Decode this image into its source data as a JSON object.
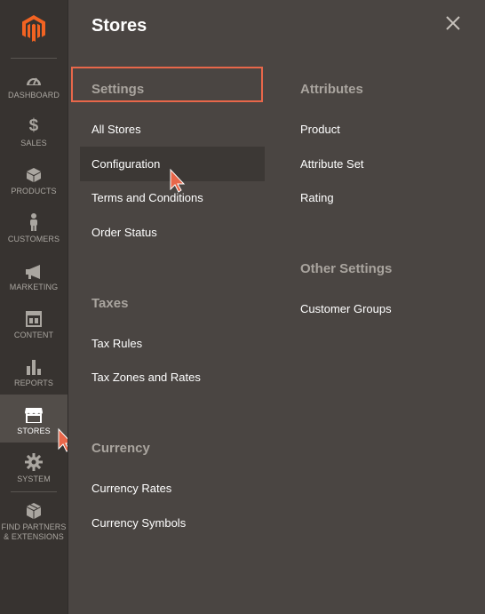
{
  "sidebar": {
    "items": [
      {
        "key": "dashboard",
        "label": "DASHBOARD"
      },
      {
        "key": "sales",
        "label": "SALES"
      },
      {
        "key": "products",
        "label": "PRODUCTS"
      },
      {
        "key": "customers",
        "label": "CUSTOMERS"
      },
      {
        "key": "marketing",
        "label": "MARKETING"
      },
      {
        "key": "content",
        "label": "CONTENT"
      },
      {
        "key": "reports",
        "label": "REPORTS"
      },
      {
        "key": "stores",
        "label": "STORES"
      },
      {
        "key": "system",
        "label": "SYSTEM"
      },
      {
        "key": "partners",
        "label_line1": "FIND PARTNERS",
        "label_line2": "& EXTENSIONS"
      }
    ],
    "active": "stores"
  },
  "panel": {
    "title": "Stores",
    "settings": {
      "title": "Settings",
      "links": [
        "All Stores",
        "Configuration",
        "Terms and Conditions",
        "Order Status"
      ]
    },
    "taxes": {
      "title": "Taxes",
      "links": [
        "Tax Rules",
        "Tax Zones and Rates"
      ]
    },
    "currency": {
      "title": "Currency",
      "links": [
        "Currency Rates",
        "Currency Symbols"
      ]
    },
    "attributes": {
      "title": "Attributes",
      "links": [
        "Product",
        "Attribute Set",
        "Rating"
      ]
    },
    "other_settings": {
      "title": "Other Settings",
      "links": [
        "Customer Groups"
      ]
    }
  },
  "colors": {
    "sidebar_bg": "#373330",
    "panel_bg": "#4a4542",
    "accent": "#e8674a",
    "section_title": "#a9a49e"
  }
}
